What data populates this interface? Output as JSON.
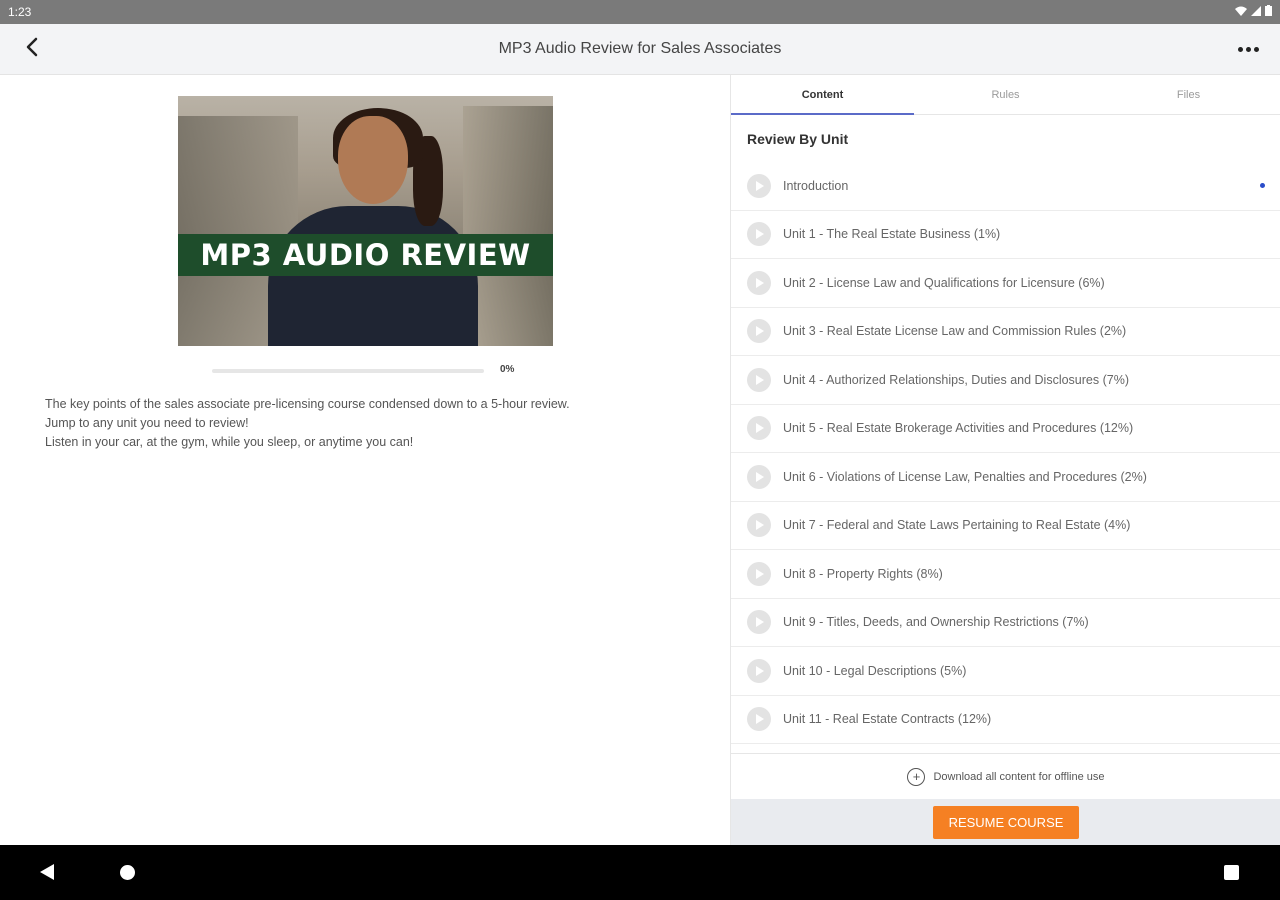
{
  "status_bar": {
    "time": "1:23",
    "icons": [
      "wifi-icon",
      "signal-icon",
      "battery-icon"
    ]
  },
  "app_bar": {
    "title": "MP3 Audio Review for Sales Associates",
    "back_icon": "back-arrow-icon",
    "more_icon": "more-horizontal-icon"
  },
  "course": {
    "banner_text": "MP3 AUDIO REVIEW",
    "progress_percent": 0,
    "progress_label": "0%",
    "description": [
      "The key points of the sales associate pre-licensing course condensed down to a 5-hour review.",
      "Jump to any unit you need to review!",
      "Listen in your car, at the gym, while you sleep, or anytime you can!"
    ]
  },
  "tabs": [
    {
      "label": "Content",
      "active": true
    },
    {
      "label": "Rules",
      "active": false
    },
    {
      "label": "Files",
      "active": false
    }
  ],
  "content": {
    "section_title": "Review By Unit",
    "units": [
      {
        "label": "Introduction",
        "current": true
      },
      {
        "label": "Unit 1 - The Real Estate Business (1%)"
      },
      {
        "label": "Unit 2 - License Law and Qualifications for Licensure (6%)"
      },
      {
        "label": "Unit 3 - Real Estate License Law and Commission Rules (2%)"
      },
      {
        "label": "Unit 4 - Authorized Relationships, Duties and Disclosures (7%)"
      },
      {
        "label": "Unit 5 - Real Estate Brokerage Activities and Procedures (12%)"
      },
      {
        "label": "Unit 6 - Violations of License Law, Penalties and Procedures (2%)"
      },
      {
        "label": "Unit 7 - Federal and State Laws Pertaining to Real Estate (4%)"
      },
      {
        "label": "Unit 8 - Property Rights (8%)"
      },
      {
        "label": "Unit 9 - Titles, Deeds, and Ownership Restrictions (7%)"
      },
      {
        "label": "Unit 10 - Legal Descriptions (5%)"
      },
      {
        "label": "Unit 11 - Real Estate Contracts (12%)"
      }
    ],
    "download_label": "Download all content for offline use",
    "resume_label": "RESUME COURSE"
  },
  "colors": {
    "accent": "#5b6bc8",
    "resume_button": "#f58023",
    "banner_green": "#1e4d2b",
    "current_dot": "#2a4cc9"
  }
}
